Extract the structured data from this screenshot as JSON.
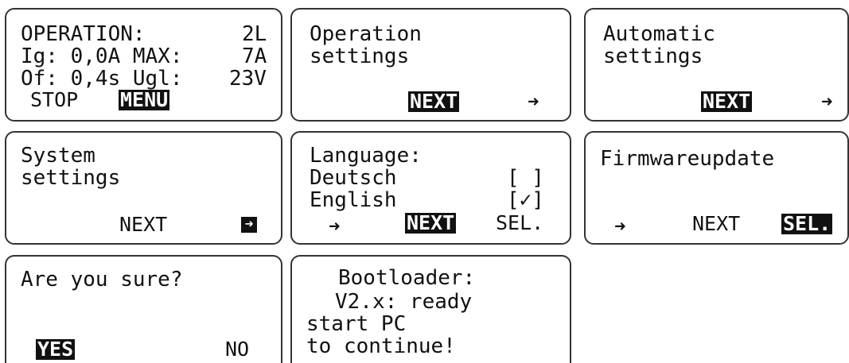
{
  "screens": {
    "s1": {
      "line1_left": "OPERATION:",
      "line1_right": "2L",
      "line2_left": "Ig: 0,0A MAX:",
      "line2_right": "7A",
      "line3_left": "Of: 0,4s Ugl:",
      "line3_right": "23V",
      "stop_label": "STOP",
      "menu_label": "MENU"
    },
    "s2": {
      "line1": "Operation",
      "line2": "settings",
      "next_label": "NEXT",
      "arrow_icon": "right-arrow-icon"
    },
    "s3": {
      "line1": "Automatic",
      "line2": "settings",
      "next_label": "NEXT",
      "arrow_icon": "right-arrow-icon"
    },
    "s4": {
      "line1": "System",
      "line2": "settings",
      "next_label": "NEXT",
      "arrow_icon": "boxed-right-arrow-icon"
    },
    "s5": {
      "title": "Language:",
      "opt1_label": "Deutsch",
      "opt1_box": "[ ]",
      "opt2_label": "English",
      "opt2_box": "[✓]",
      "next_label": "NEXT",
      "sel_label": "SEL.",
      "arrow_icon": "right-arrow-icon"
    },
    "s6": {
      "title": "Firmwareupdate",
      "next_label": "NEXT",
      "sel_label": "SEL.",
      "arrow_icon": "right-arrow-icon"
    },
    "s7": {
      "question": "Are you sure?",
      "yes_label": "YES",
      "no_label": "NO"
    },
    "s8": {
      "line1": "Bootloader:",
      "line2": "V2.x: ready",
      "line3": "start PC",
      "line4": "to continue!"
    }
  }
}
